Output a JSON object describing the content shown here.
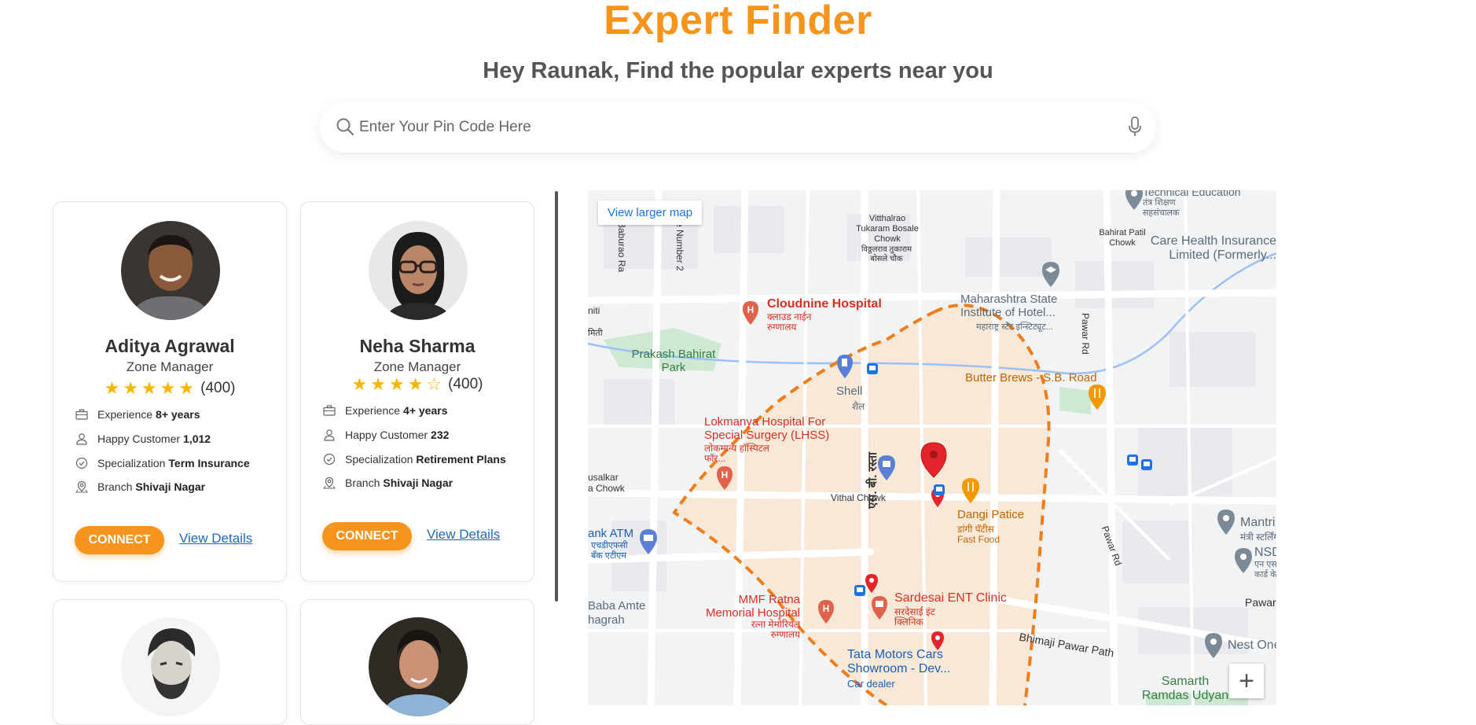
{
  "header": {
    "title": "Expert Finder",
    "subtitle": "Hey Raunak, Find the popular experts near you"
  },
  "search": {
    "placeholder": "Enter Your Pin Code Here"
  },
  "labels": {
    "experience": "Experience",
    "happy_customer": "Happy Customer",
    "specialization": "Specialization",
    "branch": "Branch",
    "connect": "CONNECT",
    "view_details": "View Details"
  },
  "experts": [
    {
      "name": "Aditya Agrawal",
      "role": "Zone Manager",
      "rating": 5,
      "rating_count": "(400)",
      "experience": "8+ years",
      "happy_customers": "1,012",
      "specialization": "Term Insurance",
      "branch": "Shivaji Nagar"
    },
    {
      "name": "Neha Sharma",
      "role": "Zone Manager",
      "rating": 4,
      "rating_count": "(400)",
      "experience": "4+ years",
      "happy_customers": "232",
      "specialization": "Retirement Plans",
      "branch": "Shivaji Nagar"
    }
  ],
  "colors": {
    "brand_orange": "#f7941d",
    "star": "#f7b500",
    "link_blue": "#1a6bbd"
  },
  "map": {
    "view_larger": "View larger map",
    "zoom_in": "+",
    "places": {
      "cloudnine": "Cloudnine Hospital",
      "cloudnine_mr": "क्लाउड नाईन रुग्णालय",
      "prakash_park": "Prakash Bahirat Park",
      "shell": "Shell",
      "shell_mr": "शैल",
      "lokmanya": "Lokmanya Hospital For Special Surgery (LHSS)",
      "lokmanya_mr": "लोकमान्य हॉस्पिटल फॉर...",
      "maharashtra": "Maharashtra State Institute of Hotel...",
      "maharashtra_mr": "महाराष्ट्र स्टेट इन्स्टिट्यूट...",
      "butter_brews": "Butter Brews - S.B. Road",
      "dangi": "Dangi Patice",
      "dangi_mr": "डांगी पॅटीस",
      "dangi_type": "Fast Food",
      "vithal_chowk": "Vithal Chowk",
      "mmf": "MMF Ratna Memorial Hospital",
      "mmf_mr": "रत्ना मेमोरियल रुग्णालय",
      "sardesai": "Sardesai ENT Clinic",
      "sardesai_mr": "सरदेसाई इंट क्लिनिक",
      "tata": "Tata Motors Cars Showroom - Dev...",
      "tata_type": "Car dealer",
      "care_health": "Care Health Insurance Limited (Formerly...",
      "mantri": "Mantri Stee",
      "mantri_mr": "मंत्री स्टर्लिंग",
      "nsdl": "NSDI",
      "nsdl_mr": "एन एस कार्ड के",
      "nest_one": "Nest One",
      "samarth": "Samarth Ramdas Udyan",
      "baba_amte": "Baba Amte",
      "baba_amte2": "hagrah",
      "atm": "ank ATM",
      "atm_mr": "एचडीएफसी बँक एटीएम",
      "vitthalrao": "Vitthalrao Tukaram Bosale Chowk",
      "vitthalrao_mr": "विठ्ठलराव तुकाराम बोसले चौक",
      "bahirat_patil": "Bahirat Patil Chowk",
      "pawar_rd": "Pawar Rd",
      "pawar_rd2": "Pawar Rd",
      "pawar": "Pawar",
      "bhimaji": "Bhimaji Pawar Path",
      "sb_road_mr": "एस. बी. रस्ता",
      "baburao": "Baburao Ra",
      "number2": "e Number 2",
      "technical": "Technical Education",
      "technical_mr": "तंत्र शिक्षण सहसंचालक",
      "usalkar": "usalkar",
      "usalkar2": "a Chowk",
      "niti": "niti",
      "niti2": "मिती"
    }
  }
}
